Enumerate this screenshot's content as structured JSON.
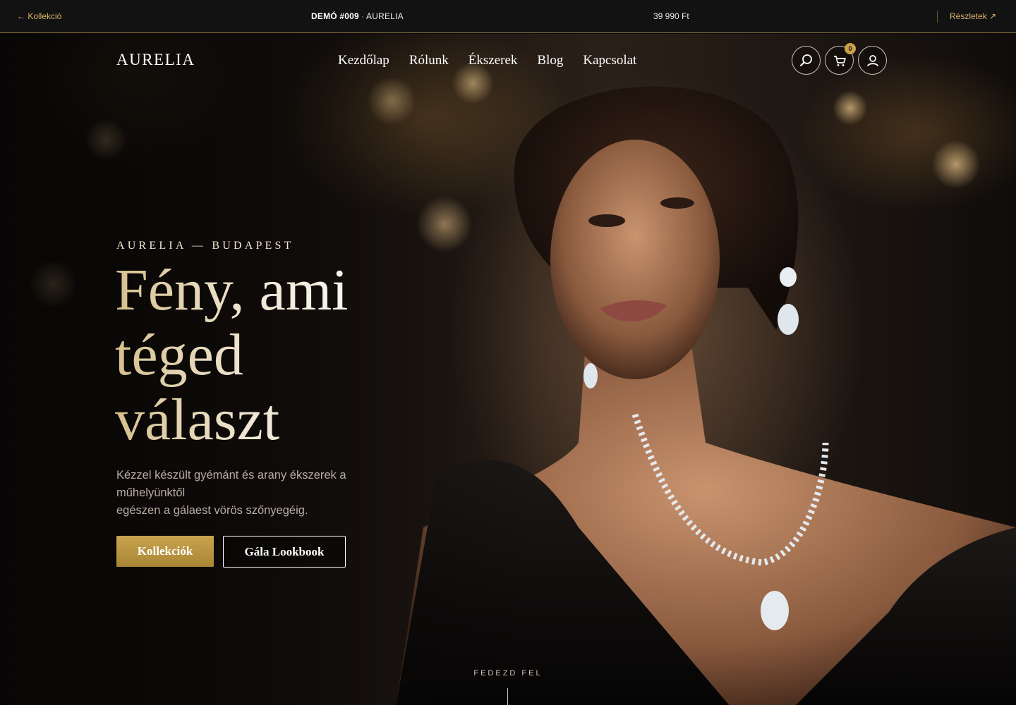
{
  "topbar": {
    "back_label": "← Kollekció",
    "demo_prefix": "DEMÓ #009",
    "demo_sep": "·",
    "demo_name": "AURELIA",
    "price": "39 990 Ft",
    "details_label": "Részletek ↗"
  },
  "header": {
    "logo": "AURELIA",
    "nav": [
      "Kezdőlap",
      "Rólunk",
      "Ékszerek",
      "Blog",
      "Kapcsolat"
    ],
    "cart_count": "0",
    "icons": [
      "search-icon",
      "cart-icon",
      "user-icon"
    ]
  },
  "hero": {
    "eyebrow": "AURELIA — BUDAPEST",
    "headline": [
      "Fény, ami",
      "téged",
      "választ"
    ],
    "subtitle": [
      "Kézzel készült gyémánt és arany ékszerek a",
      "műhelyünktől",
      "egészen a gálaest vörös szőnyegéig."
    ],
    "primary_cta": "Kollekciók",
    "secondary_cta": "Gála Lookbook",
    "scroll_cue": "FEDEZD FEL"
  },
  "colors": {
    "accent_gold": "#c9a14a",
    "background": "#0b0908",
    "topbar": "#121212"
  }
}
